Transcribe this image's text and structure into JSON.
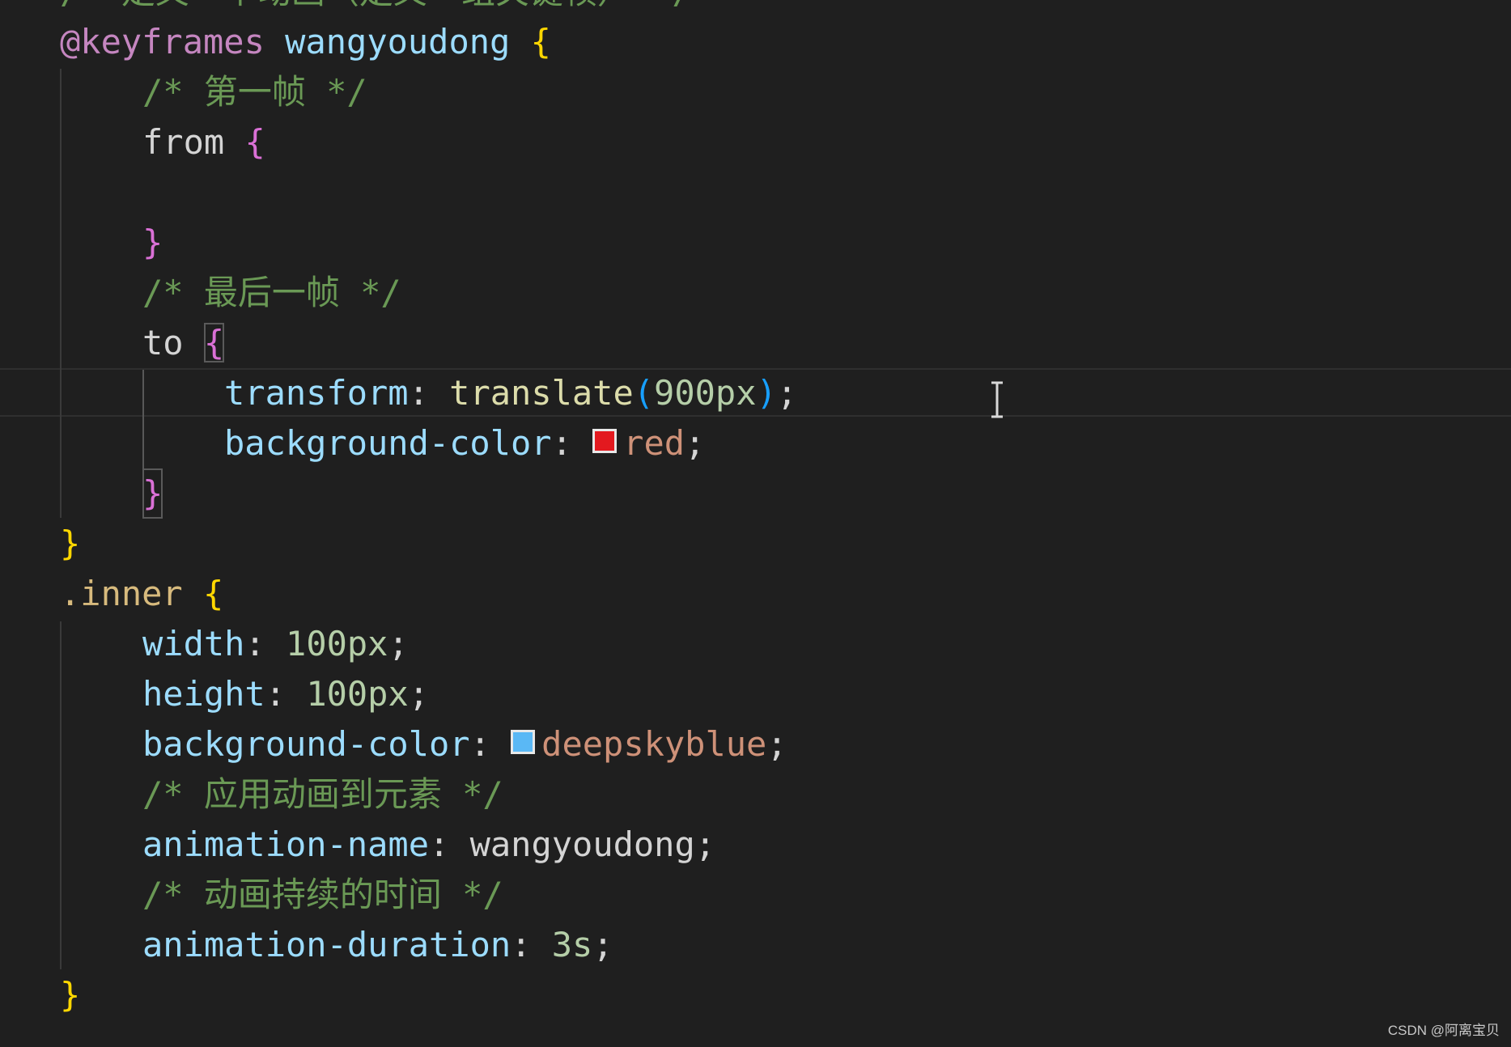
{
  "editor": {
    "language": "css",
    "lines": {
      "l0_comment": "/* 定义一个动画（定义一组关键帧） */",
      "l1_at": "@keyframes",
      "l1_name": "wangyoudong",
      "l1_brace": "{",
      "l2_comment": "/* 第一帧 */",
      "l3_key": "from",
      "l3_brace": "{",
      "l5_brace": "}",
      "l6_comment": "/* 最后一帧 */",
      "l7_key": "to",
      "l7_brace": "{",
      "l8_prop": "transform",
      "l8_colon": ":",
      "l8_fn": "translate",
      "l8_paren_open": "(",
      "l8_num": "900px",
      "l8_paren_close": ")",
      "l8_semi": ";",
      "l9_prop": "background-color",
      "l9_colon": ":",
      "l9_value": "red",
      "l9_semi": ";",
      "l10_brace": "}",
      "l11_brace": "}",
      "l12_selector": ".inner",
      "l12_brace": "{",
      "l13_prop": "width",
      "l13_colon": ":",
      "l13_num": "100px",
      "l13_semi": ";",
      "l14_prop": "height",
      "l14_colon": ":",
      "l14_num": "100px",
      "l14_semi": ";",
      "l15_prop": "background-color",
      "l15_colon": ":",
      "l15_value": "deepskyblue",
      "l15_semi": ";",
      "l16_comment": "/* 应用动画到元素 */",
      "l17_prop": "animation-name",
      "l17_colon": ":",
      "l17_value": "wangyoudong",
      "l17_semi": ";",
      "l18_comment": "/* 动画持续的时间 */",
      "l19_prop": "animation-duration",
      "l19_colon": ":",
      "l19_num": "3s",
      "l19_semi": ";",
      "l20_brace": "}"
    },
    "swatches": {
      "red": "#e3191f",
      "deepskyblue": "#5ab8f5"
    }
  },
  "watermark": "CSDN @阿离宝贝"
}
